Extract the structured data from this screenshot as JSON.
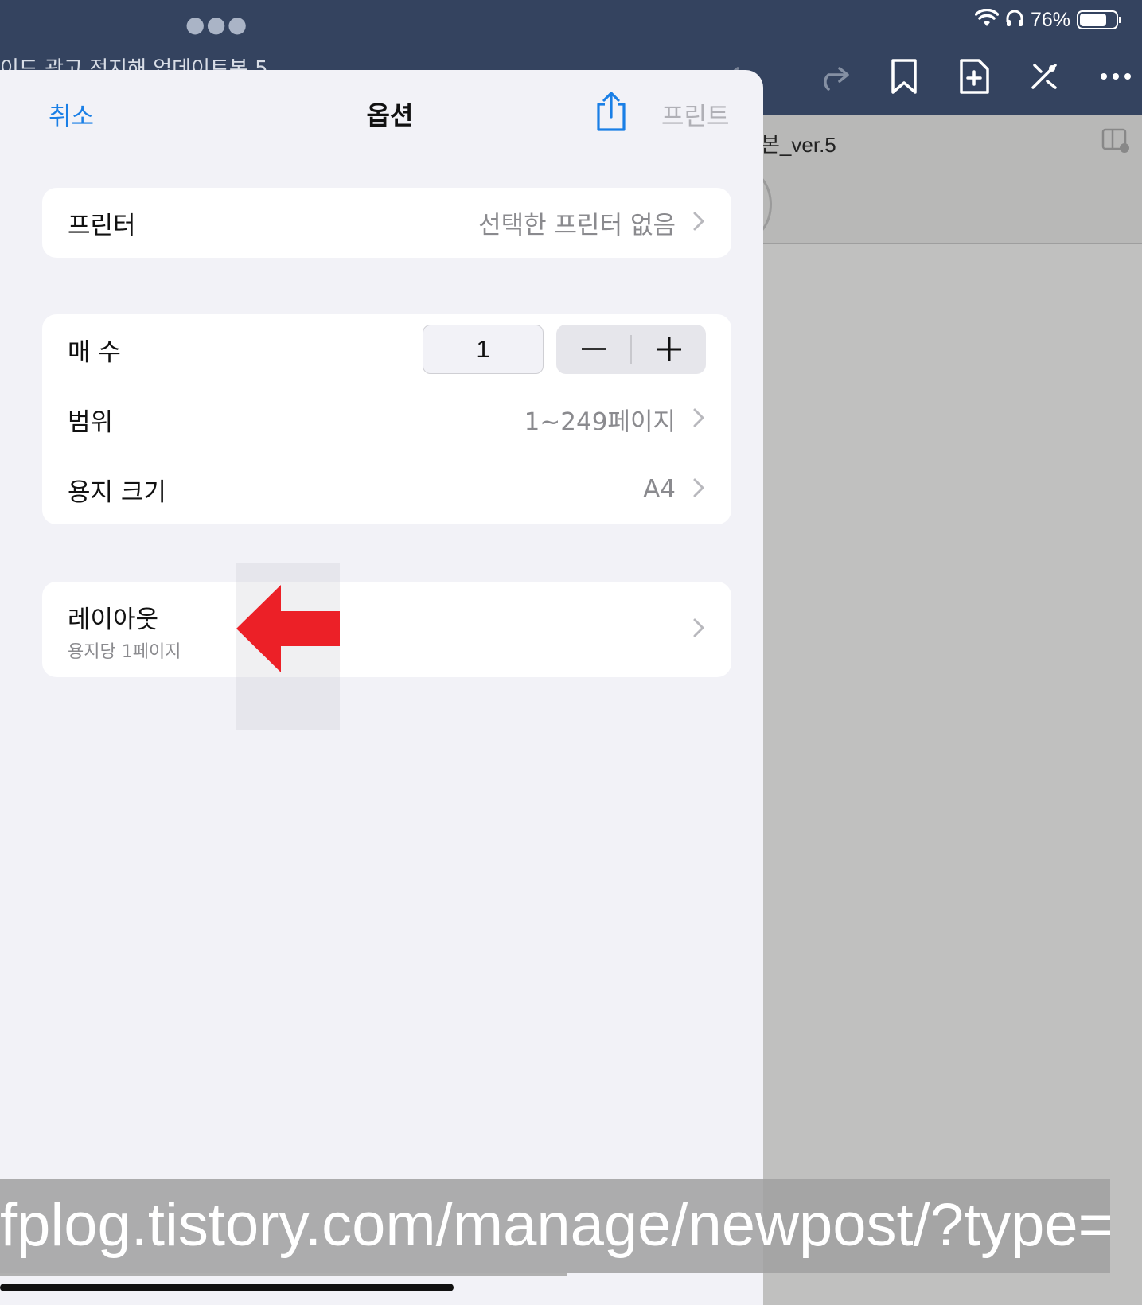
{
  "status_bar": {
    "battery_percent": "76%",
    "battery_level": 0.76
  },
  "background": {
    "doc_title_fragment": "이드 광고 정지해 업데이트본 5",
    "doc_name": "본_ver.5"
  },
  "sheet": {
    "cancel_label": "취소",
    "title": "옵션",
    "print_label": "프린트",
    "printer": {
      "label": "프린터",
      "value": "선택한 프린터 없음"
    },
    "copies": {
      "label": "매 수",
      "value": "1"
    },
    "range": {
      "label": "범위",
      "value": "1~249페이지"
    },
    "paper_size": {
      "label": "용지 크기",
      "value": "A4"
    },
    "layout": {
      "label": "레이아웃",
      "sub": "용지당 1페이지"
    }
  },
  "watermark": {
    "url": "fplog.tistory.com/manage/newpost/?type="
  },
  "colors": {
    "accent": "#1a7fe6",
    "topbar": "#34435f",
    "annotation_arrow": "#ec2027"
  }
}
